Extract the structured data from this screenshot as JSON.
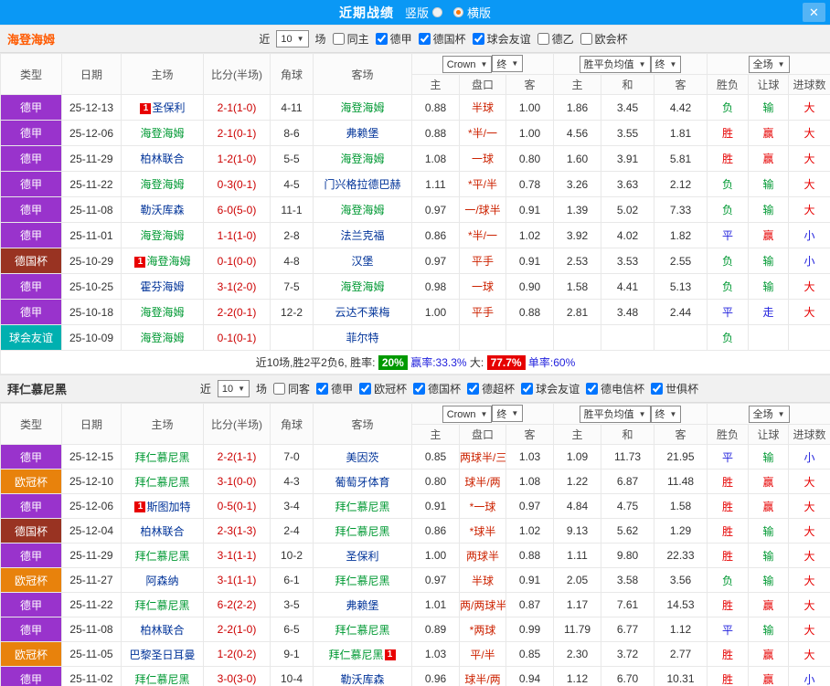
{
  "titlebar": {
    "title": "近期战绩",
    "options": [
      {
        "label": "竖版",
        "selected": false
      },
      {
        "label": "横版",
        "selected": true
      }
    ],
    "close_icon": "✕"
  },
  "icons": {
    "dropdown_arrow": "▼",
    "close": "✕"
  },
  "colors": {
    "titlebar_bg": "#0a98f5",
    "win_red": "#e60000",
    "lose_green": "#009933",
    "draw_blue": "#2222dd",
    "score_red": "#cc0000",
    "handicap_red": "#cc2200",
    "focal_team_green": "#009933",
    "opponent_navy": "#003399",
    "win_rate_badge_bg": "#009900",
    "big_rate_badge_bg": "#e60000"
  },
  "result_colors": {
    "胜": "#e60000",
    "赢": "#e60000",
    "大": "#e60000",
    "负": "#009933",
    "输": "#009933",
    "平": "#2222dd",
    "走": "#2222dd",
    "小": "#2222dd"
  },
  "league_colors": {
    "德甲": "#9933cc",
    "德国杯": "#993322",
    "球会友谊": "#00b0b0",
    "欧冠杯": "#e8820c"
  },
  "table_header": {
    "static_cols": [
      "类型",
      "日期",
      "主场",
      "比分(半场)",
      "角球",
      "客场"
    ],
    "sub_cols": [
      "主",
      "盘口",
      "客",
      "主",
      "和",
      "客",
      "胜负",
      "让球",
      "进球数"
    ],
    "odds_source_dropdown": "Crown",
    "odds_final_dropdown": "终",
    "mean_dropdown": "胜平负均值",
    "mean_final_dropdown": "终",
    "scope_dropdown": "全场"
  },
  "sections": [
    {
      "team": "海登海姆",
      "team_color": "#ff5a00",
      "filter": {
        "near_label": "近",
        "count": "10",
        "games_label": "场",
        "checkboxes": [
          {
            "label": "同主",
            "checked": false
          },
          {
            "label": "德甲",
            "checked": true
          },
          {
            "label": "德国杯",
            "checked": true
          },
          {
            "label": "球会友谊",
            "checked": true
          },
          {
            "label": "德乙",
            "checked": false
          },
          {
            "label": "欧会杯",
            "checked": false
          }
        ]
      },
      "rows": [
        {
          "league": "德甲",
          "date": "25-12-13",
          "home": "圣保利",
          "home_focal": false,
          "home_badge": "1",
          "home_badge_pos": "before",
          "score": "2-1(1-0)",
          "corner": "4-11",
          "away": "海登海姆",
          "away_focal": true,
          "away_badge": "",
          "away_badge_pos": "",
          "odds_home": "0.88",
          "handicap": "半球",
          "odds_away": "1.00",
          "mean_home": "1.86",
          "mean_draw": "3.45",
          "mean_away": "4.42",
          "result": "负",
          "handicap_result": "输",
          "goals": "大"
        },
        {
          "league": "德甲",
          "date": "25-12-06",
          "home": "海登海姆",
          "home_focal": true,
          "home_badge": "",
          "home_badge_pos": "",
          "score": "2-1(0-1)",
          "corner": "8-6",
          "away": "弗赖堡",
          "away_focal": false,
          "away_badge": "",
          "away_badge_pos": "",
          "odds_home": "0.88",
          "handicap": "*半/一",
          "odds_away": "1.00",
          "mean_home": "4.56",
          "mean_draw": "3.55",
          "mean_away": "1.81",
          "result": "胜",
          "handicap_result": "赢",
          "goals": "大"
        },
        {
          "league": "德甲",
          "date": "25-11-29",
          "home": "柏林联合",
          "home_focal": false,
          "home_badge": "",
          "home_badge_pos": "",
          "score": "1-2(1-0)",
          "corner": "5-5",
          "away": "海登海姆",
          "away_focal": true,
          "away_badge": "",
          "away_badge_pos": "",
          "odds_home": "1.08",
          "handicap": "一球",
          "odds_away": "0.80",
          "mean_home": "1.60",
          "mean_draw": "3.91",
          "mean_away": "5.81",
          "result": "胜",
          "handicap_result": "赢",
          "goals": "大"
        },
        {
          "league": "德甲",
          "date": "25-11-22",
          "home": "海登海姆",
          "home_focal": true,
          "home_badge": "",
          "home_badge_pos": "",
          "score": "0-3(0-1)",
          "corner": "4-5",
          "away": "门兴格拉德巴赫",
          "away_focal": false,
          "away_badge": "",
          "away_badge_pos": "",
          "odds_home": "1.11",
          "handicap": "*平/半",
          "odds_away": "0.78",
          "mean_home": "3.26",
          "mean_draw": "3.63",
          "mean_away": "2.12",
          "result": "负",
          "handicap_result": "输",
          "goals": "大"
        },
        {
          "league": "德甲",
          "date": "25-11-08",
          "home": "勒沃库森",
          "home_focal": false,
          "home_badge": "",
          "home_badge_pos": "",
          "score": "6-0(5-0)",
          "corner": "11-1",
          "away": "海登海姆",
          "away_focal": true,
          "away_badge": "",
          "away_badge_pos": "",
          "odds_home": "0.97",
          "handicap": "一/球半",
          "odds_away": "0.91",
          "mean_home": "1.39",
          "mean_draw": "5.02",
          "mean_away": "7.33",
          "result": "负",
          "handicap_result": "输",
          "goals": "大"
        },
        {
          "league": "德甲",
          "date": "25-11-01",
          "home": "海登海姆",
          "home_focal": true,
          "home_badge": "",
          "home_badge_pos": "",
          "score": "1-1(1-0)",
          "corner": "2-8",
          "away": "法兰克福",
          "away_focal": false,
          "away_badge": "",
          "away_badge_pos": "",
          "odds_home": "0.86",
          "handicap": "*半/一",
          "odds_away": "1.02",
          "mean_home": "3.92",
          "mean_draw": "4.02",
          "mean_away": "1.82",
          "result": "平",
          "handicap_result": "赢",
          "goals": "小"
        },
        {
          "league": "德国杯",
          "date": "25-10-29",
          "home": "海登海姆",
          "home_focal": true,
          "home_badge": "1",
          "home_badge_pos": "before",
          "score": "0-1(0-0)",
          "corner": "4-8",
          "away": "汉堡",
          "away_focal": false,
          "away_badge": "",
          "away_badge_pos": "",
          "odds_home": "0.97",
          "handicap": "平手",
          "odds_away": "0.91",
          "mean_home": "2.53",
          "mean_draw": "3.53",
          "mean_away": "2.55",
          "result": "负",
          "handicap_result": "输",
          "goals": "小"
        },
        {
          "league": "德甲",
          "date": "25-10-25",
          "home": "霍芬海姆",
          "home_focal": false,
          "home_badge": "",
          "home_badge_pos": "",
          "score": "3-1(2-0)",
          "corner": "7-5",
          "away": "海登海姆",
          "away_focal": true,
          "away_badge": "",
          "away_badge_pos": "",
          "odds_home": "0.98",
          "handicap": "一球",
          "odds_away": "0.90",
          "mean_home": "1.58",
          "mean_draw": "4.41",
          "mean_away": "5.13",
          "result": "负",
          "handicap_result": "输",
          "goals": "大"
        },
        {
          "league": "德甲",
          "date": "25-10-18",
          "home": "海登海姆",
          "home_focal": true,
          "home_badge": "",
          "home_badge_pos": "",
          "score": "2-2(0-1)",
          "corner": "12-2",
          "away": "云达不莱梅",
          "away_focal": false,
          "away_badge": "",
          "away_badge_pos": "",
          "odds_home": "1.00",
          "handicap": "平手",
          "odds_away": "0.88",
          "mean_home": "2.81",
          "mean_draw": "3.48",
          "mean_away": "2.44",
          "result": "平",
          "handicap_result": "走",
          "goals": "大"
        },
        {
          "league": "球会友谊",
          "date": "25-10-09",
          "home": "海登海姆",
          "home_focal": true,
          "home_badge": "",
          "home_badge_pos": "",
          "score": "0-1(0-1)",
          "corner": "",
          "away": "菲尔特",
          "away_focal": false,
          "away_badge": "",
          "away_badge_pos": "",
          "odds_home": "",
          "handicap": "",
          "odds_away": "",
          "mean_home": "",
          "mean_draw": "",
          "mean_away": "",
          "result": "负",
          "handicap_result": "",
          "goals": ""
        }
      ],
      "summary": {
        "record": "近10场,胜2平2负6, 胜率:",
        "win_rate": "20%",
        "win_rate_bg": "#009900",
        "handicap_label": "赢率:",
        "handicap_rate": "33.3%",
        "big_label": "大:",
        "big_rate": "77.7%",
        "big_rate_bg": "#e60000",
        "single_label": "单率:",
        "single_rate": "60%"
      }
    },
    {
      "team": "拜仁慕尼黑",
      "team_color": "#333333",
      "filter": {
        "near_label": "近",
        "count": "10",
        "games_label": "场",
        "checkboxes": [
          {
            "label": "同客",
            "checked": false
          },
          {
            "label": "德甲",
            "checked": true
          },
          {
            "label": "欧冠杯",
            "checked": true
          },
          {
            "label": "德国杯",
            "checked": true
          },
          {
            "label": "德超杯",
            "checked": true
          },
          {
            "label": "球会友谊",
            "checked": true
          },
          {
            "label": "德电信杯",
            "checked": true
          },
          {
            "label": "世俱杯",
            "checked": true
          }
        ]
      },
      "rows": [
        {
          "league": "德甲",
          "date": "25-12-15",
          "home": "拜仁慕尼黑",
          "home_focal": true,
          "home_badge": "",
          "home_badge_pos": "",
          "score": "2-2(1-1)",
          "corner": "7-0",
          "away": "美因茨",
          "away_focal": false,
          "away_badge": "",
          "away_badge_pos": "",
          "odds_home": "0.85",
          "handicap": "两球半/三",
          "odds_away": "1.03",
          "mean_home": "1.09",
          "mean_draw": "11.73",
          "mean_away": "21.95",
          "result": "平",
          "handicap_result": "输",
          "goals": "小"
        },
        {
          "league": "欧冠杯",
          "date": "25-12-10",
          "home": "拜仁慕尼黑",
          "home_focal": true,
          "home_badge": "",
          "home_badge_pos": "",
          "score": "3-1(0-0)",
          "corner": "4-3",
          "away": "葡萄牙体育",
          "away_focal": false,
          "away_badge": "",
          "away_badge_pos": "",
          "odds_home": "0.80",
          "handicap": "球半/两",
          "odds_away": "1.08",
          "mean_home": "1.22",
          "mean_draw": "6.87",
          "mean_away": "11.48",
          "result": "胜",
          "handicap_result": "赢",
          "goals": "大"
        },
        {
          "league": "德甲",
          "date": "25-12-06",
          "home": "斯图加特",
          "home_focal": false,
          "home_badge": "1",
          "home_badge_pos": "before",
          "score": "0-5(0-1)",
          "corner": "3-4",
          "away": "拜仁慕尼黑",
          "away_focal": true,
          "away_badge": "",
          "away_badge_pos": "",
          "odds_home": "0.91",
          "handicap": "*一球",
          "odds_away": "0.97",
          "mean_home": "4.84",
          "mean_draw": "4.75",
          "mean_away": "1.58",
          "result": "胜",
          "handicap_result": "赢",
          "goals": "大"
        },
        {
          "league": "德国杯",
          "date": "25-12-04",
          "home": "柏林联合",
          "home_focal": false,
          "home_badge": "",
          "home_badge_pos": "",
          "score": "2-3(1-3)",
          "corner": "2-4",
          "away": "拜仁慕尼黑",
          "away_focal": true,
          "away_badge": "",
          "away_badge_pos": "",
          "odds_home": "0.86",
          "handicap": "*球半",
          "odds_away": "1.02",
          "mean_home": "9.13",
          "mean_draw": "5.62",
          "mean_away": "1.29",
          "result": "胜",
          "handicap_result": "输",
          "goals": "大"
        },
        {
          "league": "德甲",
          "date": "25-11-29",
          "home": "拜仁慕尼黑",
          "home_focal": true,
          "home_badge": "",
          "home_badge_pos": "",
          "score": "3-1(1-1)",
          "corner": "10-2",
          "away": "圣保利",
          "away_focal": false,
          "away_badge": "",
          "away_badge_pos": "",
          "odds_home": "1.00",
          "handicap": "两球半",
          "odds_away": "0.88",
          "mean_home": "1.11",
          "mean_draw": "9.80",
          "mean_away": "22.33",
          "result": "胜",
          "handicap_result": "输",
          "goals": "大"
        },
        {
          "league": "欧冠杯",
          "date": "25-11-27",
          "home": "阿森纳",
          "home_focal": false,
          "home_badge": "",
          "home_badge_pos": "",
          "score": "3-1(1-1)",
          "corner": "6-1",
          "away": "拜仁慕尼黑",
          "away_focal": true,
          "away_badge": "",
          "away_badge_pos": "",
          "odds_home": "0.97",
          "handicap": "半球",
          "odds_away": "0.91",
          "mean_home": "2.05",
          "mean_draw": "3.58",
          "mean_away": "3.56",
          "result": "负",
          "handicap_result": "输",
          "goals": "大"
        },
        {
          "league": "德甲",
          "date": "25-11-22",
          "home": "拜仁慕尼黑",
          "home_focal": true,
          "home_badge": "",
          "home_badge_pos": "",
          "score": "6-2(2-2)",
          "corner": "3-5",
          "away": "弗赖堡",
          "away_focal": false,
          "away_badge": "",
          "away_badge_pos": "",
          "odds_home": "1.01",
          "handicap": "两/两球半",
          "odds_away": "0.87",
          "mean_home": "1.17",
          "mean_draw": "7.61",
          "mean_away": "14.53",
          "result": "胜",
          "handicap_result": "赢",
          "goals": "大"
        },
        {
          "league": "德甲",
          "date": "25-11-08",
          "home": "柏林联合",
          "home_focal": false,
          "home_badge": "",
          "home_badge_pos": "",
          "score": "2-2(1-0)",
          "corner": "6-5",
          "away": "拜仁慕尼黑",
          "away_focal": true,
          "away_badge": "",
          "away_badge_pos": "",
          "odds_home": "0.89",
          "handicap": "*两球",
          "odds_away": "0.99",
          "mean_home": "11.79",
          "mean_draw": "6.77",
          "mean_away": "1.12",
          "result": "平",
          "handicap_result": "输",
          "goals": "大"
        },
        {
          "league": "欧冠杯",
          "date": "25-11-05",
          "home": "巴黎圣日耳曼",
          "home_focal": false,
          "home_badge": "",
          "home_badge_pos": "",
          "score": "1-2(0-2)",
          "corner": "9-1",
          "away": "拜仁慕尼黑",
          "away_focal": true,
          "away_badge": "1",
          "away_badge_pos": "after",
          "odds_home": "1.03",
          "handicap": "平/半",
          "odds_away": "0.85",
          "mean_home": "2.30",
          "mean_draw": "3.72",
          "mean_away": "2.77",
          "result": "胜",
          "handicap_result": "赢",
          "goals": "大"
        },
        {
          "league": "德甲",
          "date": "25-11-02",
          "home": "拜仁慕尼黑",
          "home_focal": true,
          "home_badge": "",
          "home_badge_pos": "",
          "score": "3-0(3-0)",
          "corner": "10-4",
          "away": "勒沃库森",
          "away_focal": false,
          "away_badge": "",
          "away_badge_pos": "",
          "odds_home": "0.96",
          "handicap": "球半/两",
          "odds_away": "0.94",
          "mean_home": "1.12",
          "mean_draw": "6.70",
          "mean_away": "10.31",
          "result": "胜",
          "handicap_result": "赢",
          "goals": "小"
        }
      ]
    }
  ]
}
